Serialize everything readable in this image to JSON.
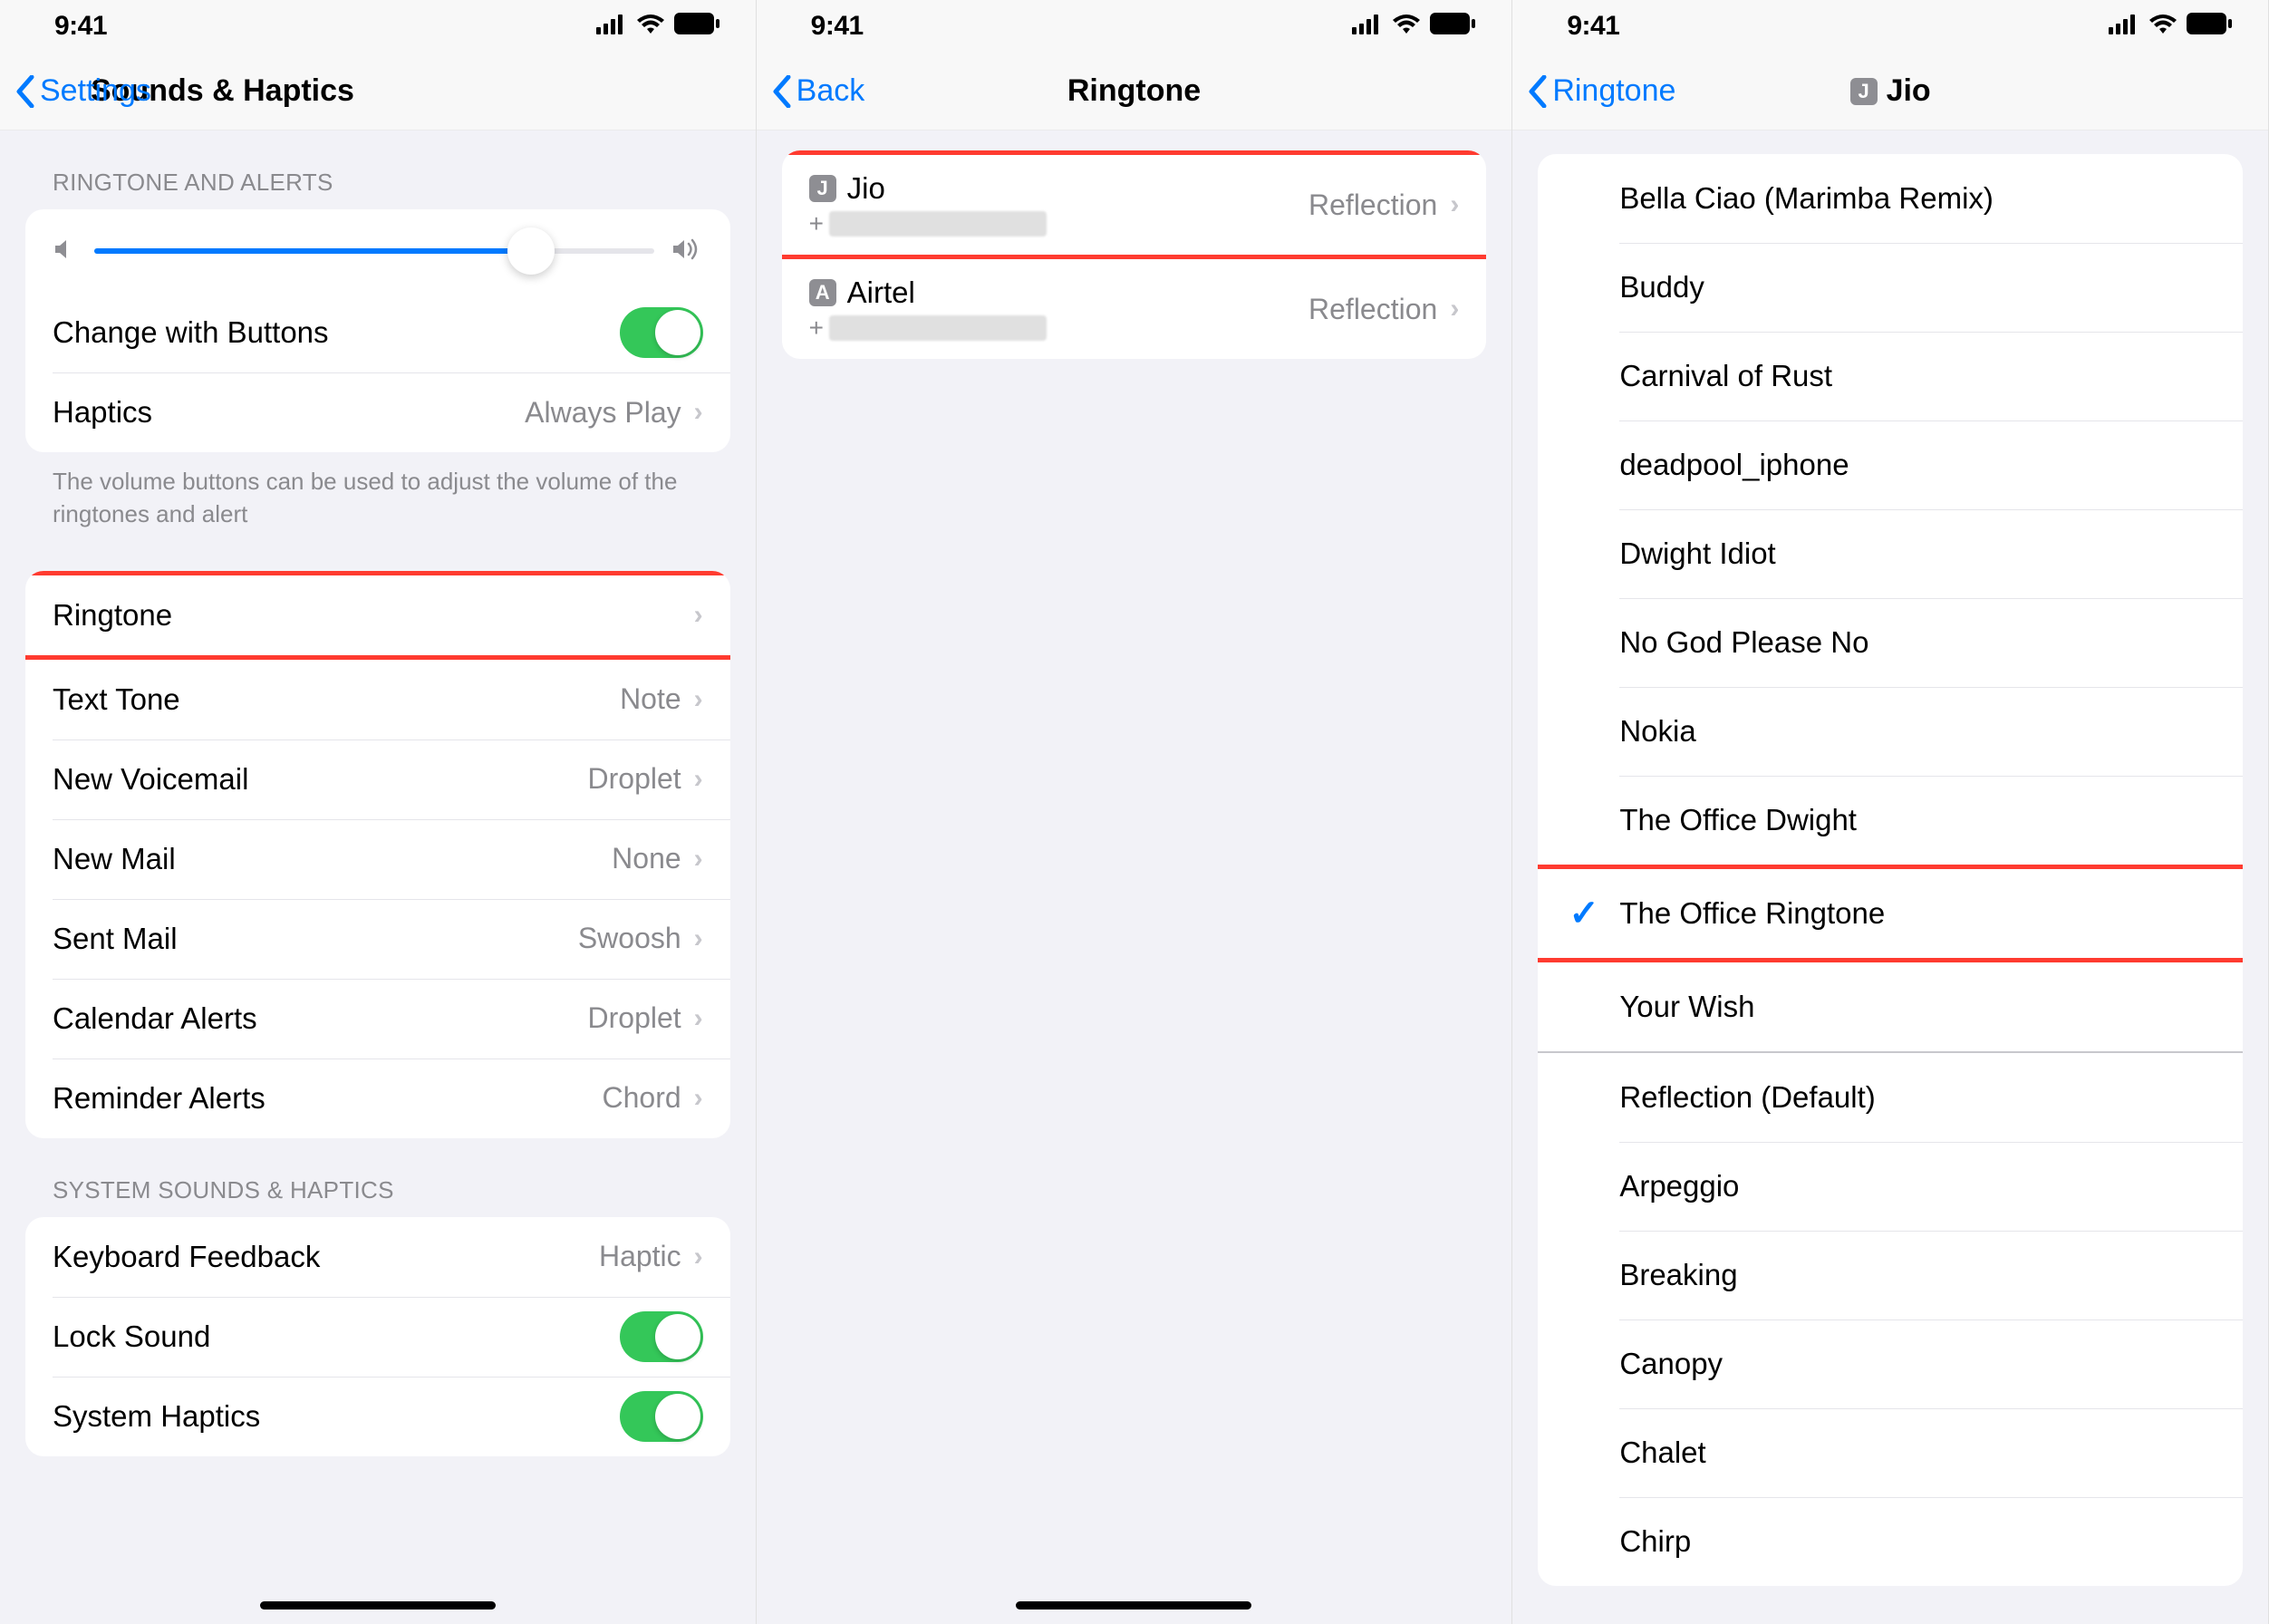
{
  "status": {
    "time": "9:41"
  },
  "screen1": {
    "back": "Settings",
    "title": "Sounds & Haptics",
    "section_ringtone_alerts": "RINGTONE AND ALERTS",
    "change_with_buttons": "Change with Buttons",
    "haptics_label": "Haptics",
    "haptics_value": "Always Play",
    "footer_volume": "The volume buttons can be used to adjust the volume of the ringtones and alert",
    "ringtone_label": "Ringtone",
    "text_tone_label": "Text Tone",
    "text_tone_value": "Note",
    "new_voicemail_label": "New Voicemail",
    "new_voicemail_value": "Droplet",
    "new_mail_label": "New Mail",
    "new_mail_value": "None",
    "sent_mail_label": "Sent Mail",
    "sent_mail_value": "Swoosh",
    "calendar_alerts_label": "Calendar Alerts",
    "calendar_alerts_value": "Droplet",
    "reminder_alerts_label": "Reminder Alerts",
    "reminder_alerts_value": "Chord",
    "section_system": "SYSTEM SOUNDS & HAPTICS",
    "keyboard_feedback_label": "Keyboard Feedback",
    "keyboard_feedback_value": "Haptic",
    "lock_sound_label": "Lock Sound",
    "system_haptics_label": "System Haptics"
  },
  "screen2": {
    "back": "Back",
    "title": "Ringtone",
    "sim1_badge": "J",
    "sim1_name": "Jio",
    "sim1_prefix": "+",
    "sim1_value": "Reflection",
    "sim2_badge": "A",
    "sim2_name": "Airtel",
    "sim2_prefix": "+",
    "sim2_value": "Reflection"
  },
  "screen3": {
    "back": "Ringtone",
    "title_badge": "J",
    "title": "Jio",
    "ringtones_custom": [
      "Bella Ciao (Marimba Remix)",
      "Buddy",
      "Carnival of Rust",
      "deadpool_iphone",
      "Dwight Idiot",
      "No God Please No",
      "Nokia",
      "The Office Dwight",
      "The Office Ringtone",
      "Your Wish"
    ],
    "ringtones_builtin": [
      "Reflection (Default)",
      "Arpeggio",
      "Breaking",
      "Canopy",
      "Chalet",
      "Chirp"
    ],
    "selected_index": 8
  }
}
